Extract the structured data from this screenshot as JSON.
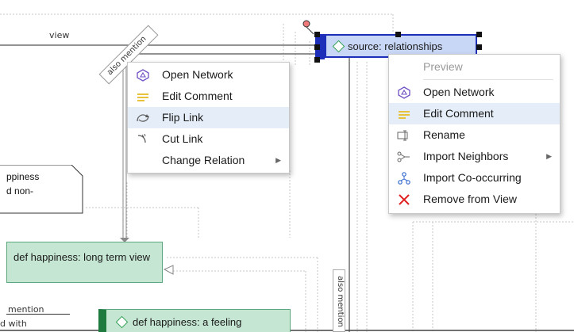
{
  "canvas": {
    "edge_labels": {
      "view": "view",
      "also_mention_left": "also mention",
      "also_mention_right": "also mention"
    },
    "nodes": {
      "source": "source: relationships",
      "def_long_term": "def happiness: long term view",
      "def_feeling": "def happiness: a feeling",
      "comment_line1": "ppiness",
      "comment_line2": "d non-",
      "partial_mention": "mention",
      "partial_with": "d with"
    }
  },
  "link_menu": {
    "items": [
      {
        "label": "Open Network",
        "icon": "network-icon"
      },
      {
        "label": "Edit Comment",
        "icon": "comment-icon"
      },
      {
        "label": "Flip Link",
        "icon": "flip-link-icon"
      },
      {
        "label": "Cut Link",
        "icon": "cut-link-icon"
      },
      {
        "label": "Change Relation",
        "icon": "none"
      }
    ]
  },
  "node_menu": {
    "items": [
      {
        "label": "Preview"
      },
      {
        "label": "Open Network",
        "icon": "network-icon"
      },
      {
        "label": "Edit Comment",
        "icon": "comment-icon"
      },
      {
        "label": "Rename",
        "icon": "rename-icon"
      },
      {
        "label": "Import Neighbors",
        "icon": "import-neighbors-icon"
      },
      {
        "label": "Import Co-occurring",
        "icon": "import-cooccurring-icon"
      },
      {
        "label": "Remove from View",
        "icon": "remove-icon"
      }
    ]
  },
  "colors": {
    "accent": "#1d2fb8",
    "node_fill": "#c5e6d2",
    "node_border": "#5fa77c",
    "comment_icon": "#e8c23a",
    "remove_icon": "#e02020",
    "network_icon": "#6f4fc4"
  }
}
